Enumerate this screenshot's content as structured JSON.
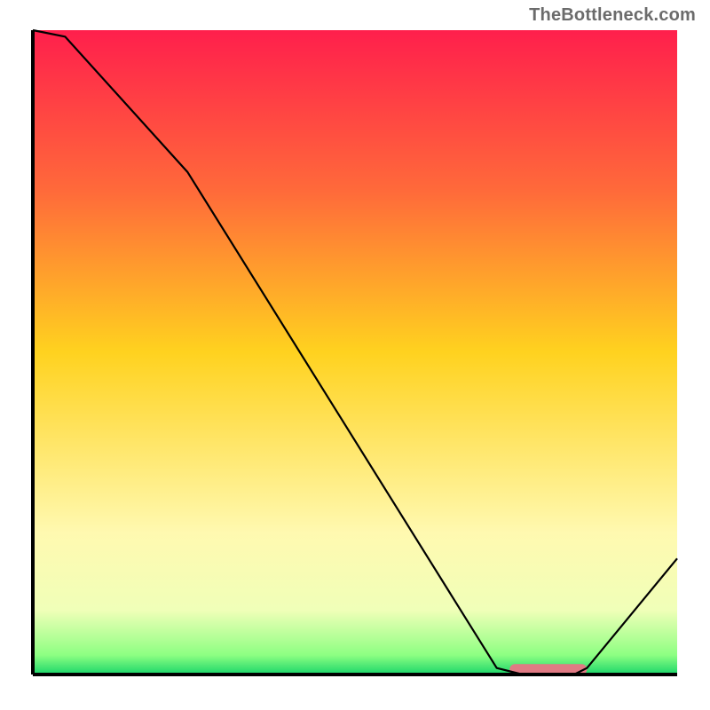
{
  "watermark": "TheBottleneck.com",
  "chart_data": {
    "type": "line",
    "title": "",
    "xlabel": "",
    "ylabel": "",
    "xlim": [
      0,
      100
    ],
    "ylim": [
      0,
      100
    ],
    "x": [
      0,
      5,
      24,
      72,
      76,
      84,
      86,
      100
    ],
    "values": [
      100,
      99,
      78,
      1,
      0,
      0,
      1,
      18
    ],
    "marker": {
      "x_range": [
        74,
        86
      ],
      "y": 0.8,
      "color": "#e07a84"
    },
    "gradient_stops": [
      {
        "pos": 0,
        "color": "#ff1f4c"
      },
      {
        "pos": 0.25,
        "color": "#ff6a3a"
      },
      {
        "pos": 0.5,
        "color": "#ffd21f"
      },
      {
        "pos": 0.78,
        "color": "#fff9b0"
      },
      {
        "pos": 0.9,
        "color": "#f0ffb8"
      },
      {
        "pos": 0.97,
        "color": "#8dff82"
      },
      {
        "pos": 1.0,
        "color": "#1ad56a"
      }
    ],
    "axis_color": "#000000",
    "line_color": "#000000",
    "line_width": 2.2
  }
}
